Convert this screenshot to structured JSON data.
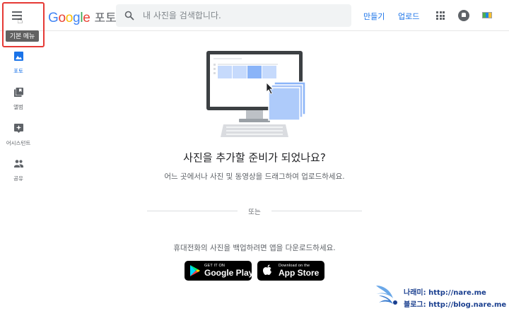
{
  "header": {
    "menu_tooltip": "기본 메뉴",
    "logo_google": "Google",
    "logo_product": "포토",
    "search_placeholder": "내 사진을 검색합니다.",
    "create_label": "만들기",
    "upload_label": "업로드"
  },
  "sidebar": {
    "items": [
      {
        "label": "포토",
        "icon": "photo-icon",
        "active": true
      },
      {
        "label": "앨범",
        "icon": "album-icon",
        "active": false
      },
      {
        "label": "어시스턴트",
        "icon": "assistant-icon",
        "active": false
      },
      {
        "label": "공유",
        "icon": "sharing-icon",
        "active": false
      }
    ]
  },
  "main": {
    "headline": "사진을 추가할 준비가 되었나요?",
    "subline": "어느 곳에서나 사진 및 동영상을 드래그하여 업로드하세요.",
    "or_label": "또는",
    "mobile_text": "휴대전화의 사진을 백업하려면 앱을 다운로드하세요.",
    "google_play": {
      "small": "GET IT ON",
      "big": "Google Play"
    },
    "app_store": {
      "small": "Download on the",
      "big": "App Store"
    }
  },
  "watermark": {
    "line1": "나래미: http://nare.me",
    "line2": "블로그: http://blog.nare.me"
  },
  "colors": {
    "accent": "#1a73e8",
    "highlight_border": "#e53935",
    "tile_blue": "#8ab4f8",
    "watermark": "#1a3f8f"
  }
}
